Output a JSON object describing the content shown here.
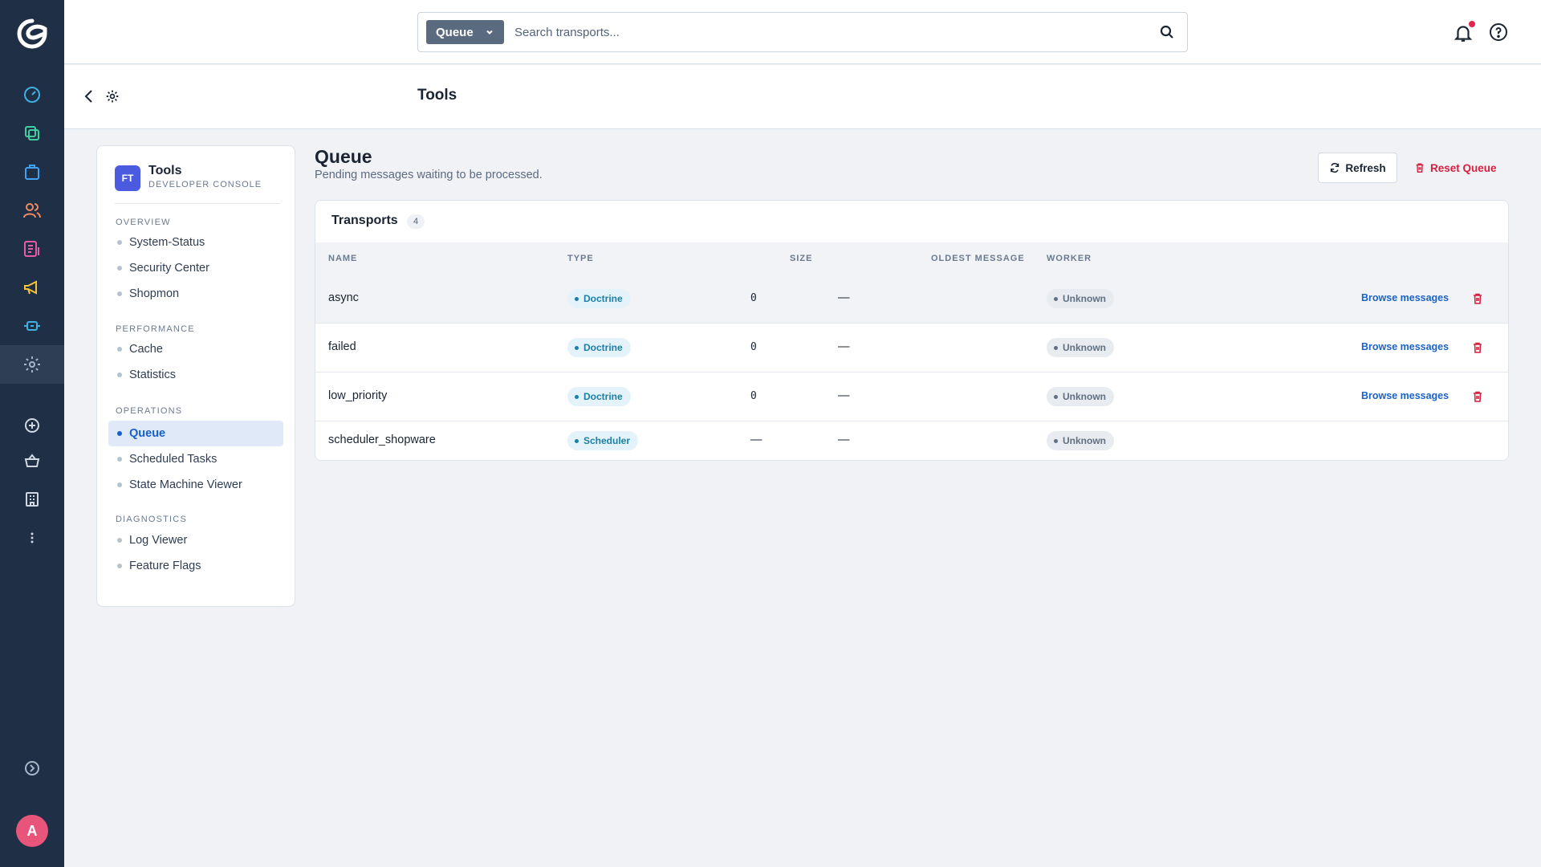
{
  "search": {
    "scope_label": "Queue",
    "placeholder": "Search transports..."
  },
  "smartbar": {
    "title": "Tools"
  },
  "nav": {
    "badge": "FT",
    "title": "Tools",
    "subtitle": "DEVELOPER CONSOLE",
    "sections": [
      {
        "label": "OVERVIEW",
        "items": [
          "System-Status",
          "Security Center",
          "Shopmon"
        ]
      },
      {
        "label": "PERFORMANCE",
        "items": [
          "Cache",
          "Statistics"
        ]
      },
      {
        "label": "OPERATIONS",
        "items": [
          "Queue",
          "Scheduled Tasks",
          "State Machine Viewer"
        ]
      },
      {
        "label": "DIAGNOSTICS",
        "items": [
          "Log Viewer",
          "Feature Flags"
        ]
      }
    ],
    "active_item": "Queue"
  },
  "main": {
    "title": "Queue",
    "subtitle": "Pending messages waiting to be processed.",
    "refresh_label": "Refresh",
    "reset_label": "Reset Queue"
  },
  "table": {
    "title": "Transports",
    "count": "4",
    "columns": [
      "NAME",
      "TYPE",
      "SIZE",
      "OLDEST MESSAGE",
      "WORKER"
    ],
    "action_label": "Browse messages",
    "rows": [
      {
        "name": "async",
        "type": "Doctrine",
        "size": "0",
        "oldest": "—",
        "worker": "Unknown"
      },
      {
        "name": "failed",
        "type": "Doctrine",
        "size": "0",
        "oldest": "—",
        "worker": "Unknown"
      },
      {
        "name": "low_priority",
        "type": "Doctrine",
        "size": "0",
        "oldest": "—",
        "worker": "Unknown"
      },
      {
        "name": "scheduler_shopware",
        "type": "Scheduler",
        "size": "—",
        "oldest": "—",
        "worker": "Unknown"
      }
    ]
  },
  "user": {
    "avatar_initial": "A"
  },
  "icons": {
    "rail": [
      "dashboard-icon",
      "catalog-icon",
      "orders-icon",
      "customers-icon",
      "content-icon",
      "marketing-icon",
      "extensions-icon",
      "settings-icon",
      "add-icon",
      "sales-channel-icon",
      "storefront-icon",
      "more-icon",
      "expand-icon"
    ]
  },
  "colors": {
    "rail_bg": "#1f2f45",
    "accent": "#1760c9",
    "danger": "#d6203f",
    "type_pill": "#1b7fa8",
    "avatar": "#e8557a",
    "notification_dot": "#e0284f"
  }
}
